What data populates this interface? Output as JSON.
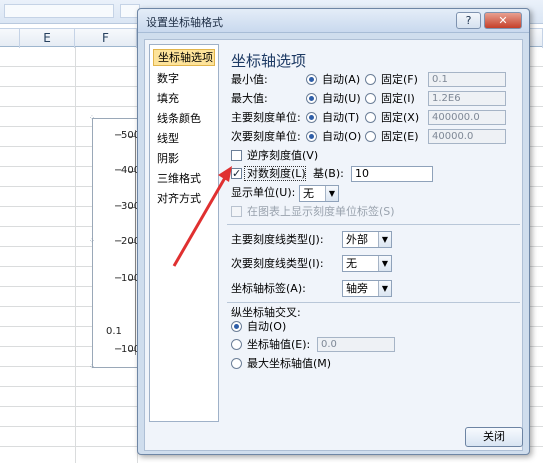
{
  "spreadsheet": {
    "columns": [
      "E",
      "F"
    ],
    "axis_ticks": [
      "500",
      "400",
      "300",
      "200",
      "100",
      "0.1",
      "100"
    ],
    "axis_tick_prefix": "−"
  },
  "dialog": {
    "title": "设置坐标轴格式",
    "help_label": "?",
    "close_icon_label": "✕",
    "close_button_label": "关闭"
  },
  "nav": {
    "items": [
      {
        "label": "坐标轴选项",
        "selected": true
      },
      {
        "label": "数字"
      },
      {
        "label": "填充"
      },
      {
        "label": "线条颜色"
      },
      {
        "label": "线型"
      },
      {
        "label": "阴影"
      },
      {
        "label": "三维格式"
      },
      {
        "label": "对齐方式"
      }
    ]
  },
  "panel": {
    "title": "坐标轴选项",
    "rows": [
      {
        "label": "最小值:",
        "auto_label": "自动(A)",
        "fixed_label": "固定(F)",
        "value": "0.1"
      },
      {
        "label": "最大值:",
        "auto_label": "自动(U)",
        "fixed_label": "固定(I)",
        "value": "1.2E6"
      },
      {
        "label": "主要刻度单位:",
        "auto_label": "自动(T)",
        "fixed_label": "固定(X)",
        "value": "400000.0"
      },
      {
        "label": "次要刻度单位:",
        "auto_label": "自动(O)",
        "fixed_label": "固定(E)",
        "value": "40000.0"
      }
    ],
    "reverse_label": "逆序刻度值(V)",
    "log_label": "对数刻度(L)",
    "base_label": "基(B):",
    "base_value": "10",
    "display_units_label": "显示单位(U):",
    "display_units_value": "无",
    "show_units_label": "在图表上显示刻度单位标签(S)",
    "major_tick_label": "主要刻度线类型(J):",
    "major_tick_value": "外部",
    "minor_tick_label": "次要刻度线类型(I):",
    "minor_tick_value": "无",
    "axis_labels_label": "坐标轴标签(A):",
    "axis_labels_value": "轴旁",
    "cross_title": "纵坐标轴交叉:",
    "cross_auto_label": "自动(O)",
    "cross_value_label": "坐标轴值(E):",
    "cross_value": "0.0",
    "cross_max_label": "最大坐标轴值(M)"
  },
  "colors": {
    "annotation_arrow": "#e03030",
    "selected_nav": "#fde39a"
  }
}
